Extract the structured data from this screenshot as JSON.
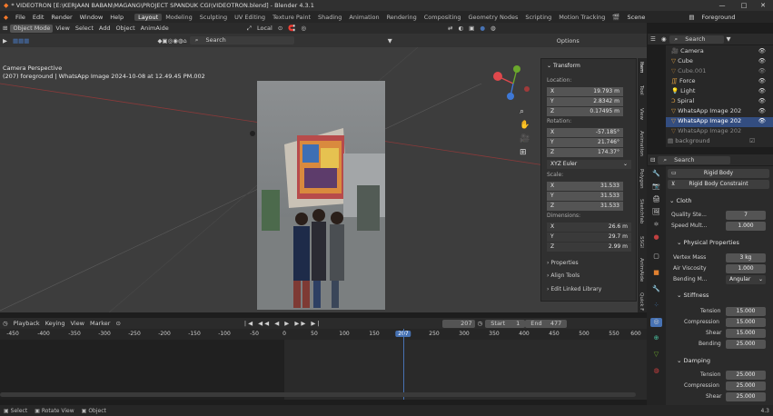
{
  "window": {
    "title": "* VIDEOTRON [E:\\KERJAAN BABAN\\MAGANG\\PROJECT SPANDUK CGI\\VIDEOTRON.blend] - Blender 4.3.1",
    "minimize": "—",
    "maximize": "□",
    "close": "✕"
  },
  "menu": {
    "file": "File",
    "edit": "Edit",
    "render": "Render",
    "window": "Window",
    "help": "Help",
    "workspaces": [
      "Layout",
      "Modeling",
      "Sculpting",
      "UV Editing",
      "Texture Paint",
      "Shading",
      "Animation",
      "Rendering",
      "Compositing",
      "Geometry Nodes",
      "Scripting",
      "Motion Tracking"
    ],
    "scene": "Scene",
    "view_layer": "Foreground"
  },
  "viewport_header": {
    "mode": "Object Mode",
    "view": "View",
    "select": "Select",
    "add": "Add",
    "object": "Object",
    "animaide": "AnimAide",
    "orientation": "Local",
    "search_placeholder": "Search",
    "options": "Options"
  },
  "viewport": {
    "perspective": "Camera Perspective",
    "active": "(207) foreground | WhatsApp Image 2024-10-08 at 12.49.45 PM.002"
  },
  "npanel": {
    "transform": "Transform",
    "location_label": "Location:",
    "rotation_label": "Rotation:",
    "euler": "XYZ Euler",
    "scale_label": "Scale:",
    "dimensions_label": "Dimensions:",
    "location": [
      {
        "axis": "X",
        "value": "19.793 m"
      },
      {
        "axis": "Y",
        "value": "2.8342 m"
      },
      {
        "axis": "Z",
        "value": "0.17495 m"
      }
    ],
    "rotation": [
      {
        "axis": "X",
        "value": "-57.185°"
      },
      {
        "axis": "Y",
        "value": "21.746°"
      },
      {
        "axis": "Z",
        "value": "174.37°"
      }
    ],
    "scale": [
      {
        "axis": "X",
        "value": "31.533"
      },
      {
        "axis": "Y",
        "value": "31.533"
      },
      {
        "axis": "Z",
        "value": "31.533"
      }
    ],
    "dimensions": [
      {
        "axis": "X",
        "value": "26.6 m"
      },
      {
        "axis": "Y",
        "value": "29.7 m"
      },
      {
        "axis": "Z",
        "value": "2.99 m"
      }
    ],
    "properties": "Properties",
    "align_tools": "Align Tools",
    "edit_linked": "Edit Linked Library"
  },
  "side_tabs": [
    "Item",
    "Tool",
    "View",
    "Animation",
    "Polygon",
    "Sketchfab",
    "SSGI",
    "AnimAide",
    "Quick F"
  ],
  "timeline": {
    "playback": "Playback",
    "keying": "Keying",
    "view": "View",
    "marker": "Marker",
    "current": "207",
    "start_label": "Start",
    "start": "1",
    "end_label": "End",
    "end": "477",
    "ticks": [
      "-450",
      "-400",
      "-350",
      "-300",
      "-250",
      "-200",
      "-150",
      "-100",
      "-50",
      "0",
      "50",
      "100",
      "150",
      "207",
      "250",
      "300",
      "350",
      "400",
      "450",
      "500",
      "550",
      "600"
    ]
  },
  "status": {
    "select": "Select",
    "rotate": "Rotate View",
    "object": "Object",
    "version": "4.3"
  },
  "outliner": {
    "search_placeholder": "Search",
    "items": [
      "Camera",
      "Cube",
      "Cube.001",
      "Force",
      "Light",
      "Spiral",
      "WhatsApp Image 202",
      "WhatsApp Image 202",
      "WhatsApp Image 202",
      "background"
    ]
  },
  "properties": {
    "search_placeholder": "Search",
    "rigid_body": "Rigid Body",
    "rigid_body_constraint": "Rigid Body Constraint",
    "cloth": "Cloth",
    "quality_label": "Quality Ste...",
    "quality": "7",
    "speed_label": "Speed Mult...",
    "speed": "1.000",
    "physical": "Physical Properties",
    "vmass_label": "Vertex Mass",
    "vmass": "3 kg",
    "air_label": "Air Viscosity",
    "air": "1.000",
    "bending_label": "Bending M...",
    "bending_model": "Angular",
    "stiffness": "Stiffness",
    "tension_label": "Tension",
    "tension": "15.000",
    "compression_label": "Compression",
    "compression": "15.000",
    "shear_label": "Shear",
    "shear": "15.000",
    "bending2_label": "Bending",
    "bending2": "25.000",
    "damping": "Damping",
    "d_tension": "25.000",
    "d_compression": "25.000",
    "d_shear": "25.000"
  },
  "colors": {
    "accent": "#4772b3",
    "selected_row": "#334d80",
    "axis_x": "#e0484c",
    "axis_y": "#6ba82c",
    "axis_z": "#3e78d6"
  }
}
